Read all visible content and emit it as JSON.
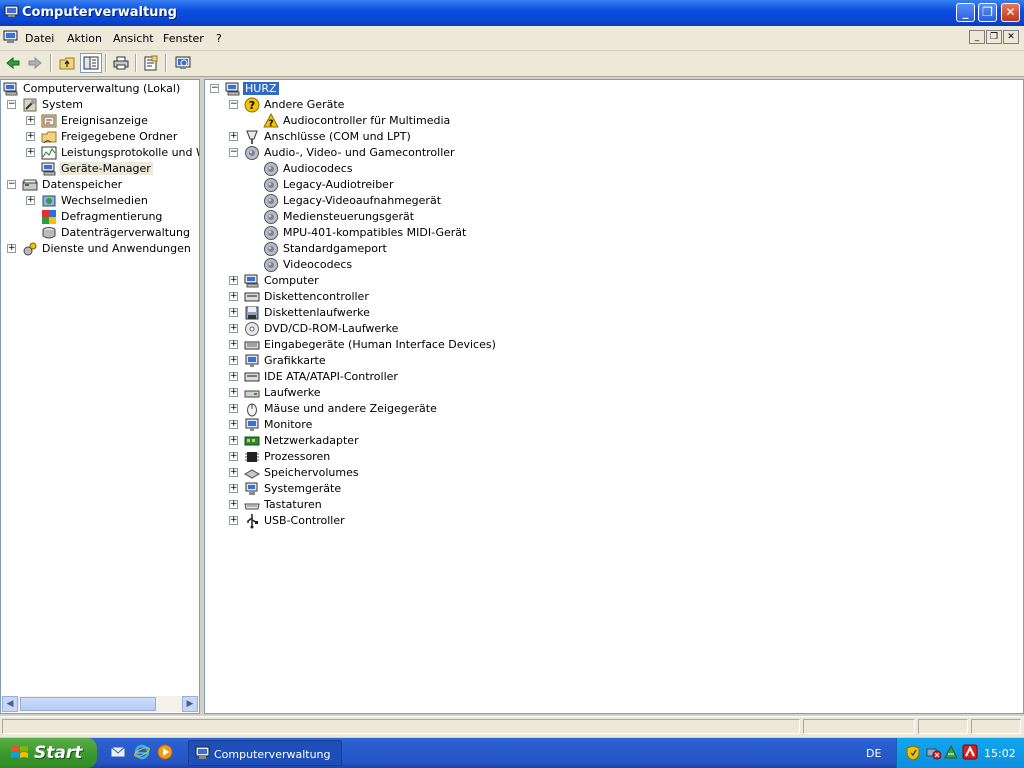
{
  "window": {
    "title": "Computerverwaltung"
  },
  "menubar": {
    "items": [
      "Datei",
      "Aktion",
      "Ansicht",
      "Fenster",
      "?"
    ]
  },
  "left_tree": [
    {
      "label": "Computerverwaltung (Lokal)",
      "icon": "computer-management-icon",
      "level": 0,
      "expander": ""
    },
    {
      "label": "System",
      "icon": "tools-icon",
      "level": 1,
      "expander": "-"
    },
    {
      "label": "Ereignisanzeige",
      "icon": "event-viewer-icon",
      "level": 2,
      "expander": "+"
    },
    {
      "label": "Freigegebene Ordner",
      "icon": "shared-folder-icon",
      "level": 2,
      "expander": "+"
    },
    {
      "label": "Leistungsprotokolle und Warn",
      "icon": "performance-logs-icon",
      "level": 2,
      "expander": "+"
    },
    {
      "label": "Geräte-Manager",
      "icon": "device-manager-icon",
      "level": 2,
      "expander": "",
      "selected": true
    },
    {
      "label": "Datenspeicher",
      "icon": "storage-icon",
      "level": 1,
      "expander": "-"
    },
    {
      "label": "Wechselmedien",
      "icon": "removable-storage-icon",
      "level": 2,
      "expander": "+"
    },
    {
      "label": "Defragmentierung",
      "icon": "defragmenter-icon",
      "level": 2,
      "expander": ""
    },
    {
      "label": "Datenträgerverwaltung",
      "icon": "disk-management-icon",
      "level": 2,
      "expander": ""
    },
    {
      "label": "Dienste und Anwendungen",
      "icon": "services-icon",
      "level": 1,
      "expander": "+"
    }
  ],
  "right_tree": [
    {
      "label": "HURZ",
      "icon": "computer-icon",
      "level": 0,
      "expander": "-",
      "selected": true
    },
    {
      "label": "Andere Geräte",
      "icon": "unknown-device-icon",
      "level": 1,
      "expander": "-"
    },
    {
      "label": "Audiocontroller für Multimedia",
      "icon": "warning-device-icon",
      "level": 2,
      "expander": ""
    },
    {
      "label": "Anschlüsse (COM und LPT)",
      "icon": "port-icon",
      "level": 1,
      "expander": "+"
    },
    {
      "label": "Audio-, Video- und Gamecontroller",
      "icon": "audio-icon",
      "level": 1,
      "expander": "-"
    },
    {
      "label": "Audiocodecs",
      "icon": "audio-icon",
      "level": 2,
      "expander": ""
    },
    {
      "label": "Legacy-Audiotreiber",
      "icon": "audio-icon",
      "level": 2,
      "expander": ""
    },
    {
      "label": "Legacy-Videoaufnahmegerät",
      "icon": "audio-icon",
      "level": 2,
      "expander": ""
    },
    {
      "label": "Mediensteuerungsgerät",
      "icon": "audio-icon",
      "level": 2,
      "expander": ""
    },
    {
      "label": "MPU-401-kompatibles MIDI-Gerät",
      "icon": "audio-icon",
      "level": 2,
      "expander": ""
    },
    {
      "label": "Standardgameport",
      "icon": "audio-icon",
      "level": 2,
      "expander": ""
    },
    {
      "label": "Videocodecs",
      "icon": "audio-icon",
      "level": 2,
      "expander": ""
    },
    {
      "label": "Computer",
      "icon": "computer-icon",
      "level": 1,
      "expander": "+"
    },
    {
      "label": "Diskettencontroller",
      "icon": "controller-icon",
      "level": 1,
      "expander": "+"
    },
    {
      "label": "Diskettenlaufwerke",
      "icon": "floppy-icon",
      "level": 1,
      "expander": "+"
    },
    {
      "label": "DVD/CD-ROM-Laufwerke",
      "icon": "cdrom-icon",
      "level": 1,
      "expander": "+"
    },
    {
      "label": "Eingabegeräte (Human Interface Devices)",
      "icon": "hid-icon",
      "level": 1,
      "expander": "+"
    },
    {
      "label": "Grafikkarte",
      "icon": "display-adapter-icon",
      "level": 1,
      "expander": "+"
    },
    {
      "label": "IDE ATA/ATAPI-Controller",
      "icon": "controller-icon",
      "level": 1,
      "expander": "+"
    },
    {
      "label": "Laufwerke",
      "icon": "drive-icon",
      "level": 1,
      "expander": "+"
    },
    {
      "label": "Mäuse und andere Zeigegeräte",
      "icon": "mouse-icon",
      "level": 1,
      "expander": "+"
    },
    {
      "label": "Monitore",
      "icon": "monitor-icon",
      "level": 1,
      "expander": "+"
    },
    {
      "label": "Netzwerkadapter",
      "icon": "network-adapter-icon",
      "level": 1,
      "expander": "+"
    },
    {
      "label": "Prozessoren",
      "icon": "processor-icon",
      "level": 1,
      "expander": "+"
    },
    {
      "label": "Speichervolumes",
      "icon": "volume-icon",
      "level": 1,
      "expander": "+"
    },
    {
      "label": "Systemgeräte",
      "icon": "system-device-icon",
      "level": 1,
      "expander": "+"
    },
    {
      "label": "Tastaturen",
      "icon": "keyboard-icon",
      "level": 1,
      "expander": "+"
    },
    {
      "label": "USB-Controller",
      "icon": "usb-icon",
      "level": 1,
      "expander": "+"
    }
  ],
  "taskbar": {
    "start_label": "Start",
    "task_label": "Computerverwaltung",
    "language": "DE",
    "clock": "15:02"
  },
  "colors": {
    "title_blue": "#0b4ee0",
    "selection": "#316ac5",
    "start_green": "#3c9a2e",
    "tray_blue": "#0d8edd"
  }
}
